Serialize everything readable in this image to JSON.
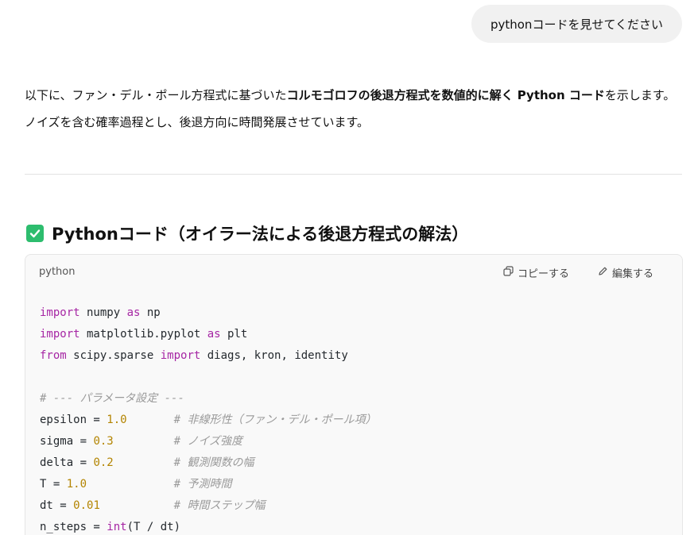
{
  "user_message": "pythonコードを見せてください",
  "answer": {
    "intro_1": "以下に、ファン・デル・ポール方程式に基づいた",
    "intro_bold": "コルモゴロフの後退方程式を数値的に解く Python コード",
    "intro_2": "を示します。ノイズを含む確率過程とし、後退方向に時間発展させています。"
  },
  "section": {
    "title": "Pythonコード（オイラー法による後退方程式の解法）",
    "icon": "check-icon",
    "icon_color": "#2dbd6e"
  },
  "code_block": {
    "language": "python",
    "copy_label": "コピーする",
    "edit_label": "編集する",
    "lines": [
      [
        {
          "t": "import",
          "c": "kw"
        },
        {
          "t": " numpy ",
          "c": ""
        },
        {
          "t": "as",
          "c": "kw"
        },
        {
          "t": " np",
          "c": ""
        }
      ],
      [
        {
          "t": "import",
          "c": "kw"
        },
        {
          "t": " matplotlib.pyplot ",
          "c": ""
        },
        {
          "t": "as",
          "c": "kw"
        },
        {
          "t": " plt",
          "c": ""
        }
      ],
      [
        {
          "t": "from",
          "c": "kw"
        },
        {
          "t": " scipy.sparse ",
          "c": ""
        },
        {
          "t": "import",
          "c": "kw"
        },
        {
          "t": " diags, kron, identity",
          "c": ""
        }
      ],
      [],
      [
        {
          "t": "# --- パラメータ設定 ---",
          "c": "cm"
        }
      ],
      [
        {
          "t": "epsilon = ",
          "c": ""
        },
        {
          "t": "1.0",
          "c": "num"
        },
        {
          "t": "       ",
          "c": ""
        },
        {
          "t": "# 非線形性（ファン・デル・ポール項）",
          "c": "cm"
        }
      ],
      [
        {
          "t": "sigma = ",
          "c": ""
        },
        {
          "t": "0.3",
          "c": "num"
        },
        {
          "t": "         ",
          "c": ""
        },
        {
          "t": "# ノイズ強度",
          "c": "cm"
        }
      ],
      [
        {
          "t": "delta = ",
          "c": ""
        },
        {
          "t": "0.2",
          "c": "num"
        },
        {
          "t": "         ",
          "c": ""
        },
        {
          "t": "# 観測関数の幅",
          "c": "cm"
        }
      ],
      [
        {
          "t": "T = ",
          "c": ""
        },
        {
          "t": "1.0",
          "c": "num"
        },
        {
          "t": "             ",
          "c": ""
        },
        {
          "t": "# 予測時間",
          "c": "cm"
        }
      ],
      [
        {
          "t": "dt = ",
          "c": ""
        },
        {
          "t": "0.01",
          "c": "num"
        },
        {
          "t": "           ",
          "c": ""
        },
        {
          "t": "# 時間ステップ幅",
          "c": "cm"
        }
      ],
      [
        {
          "t": "n_steps = ",
          "c": ""
        },
        {
          "t": "int",
          "c": "kw"
        },
        {
          "t": "(T / dt)",
          "c": ""
        }
      ]
    ]
  }
}
